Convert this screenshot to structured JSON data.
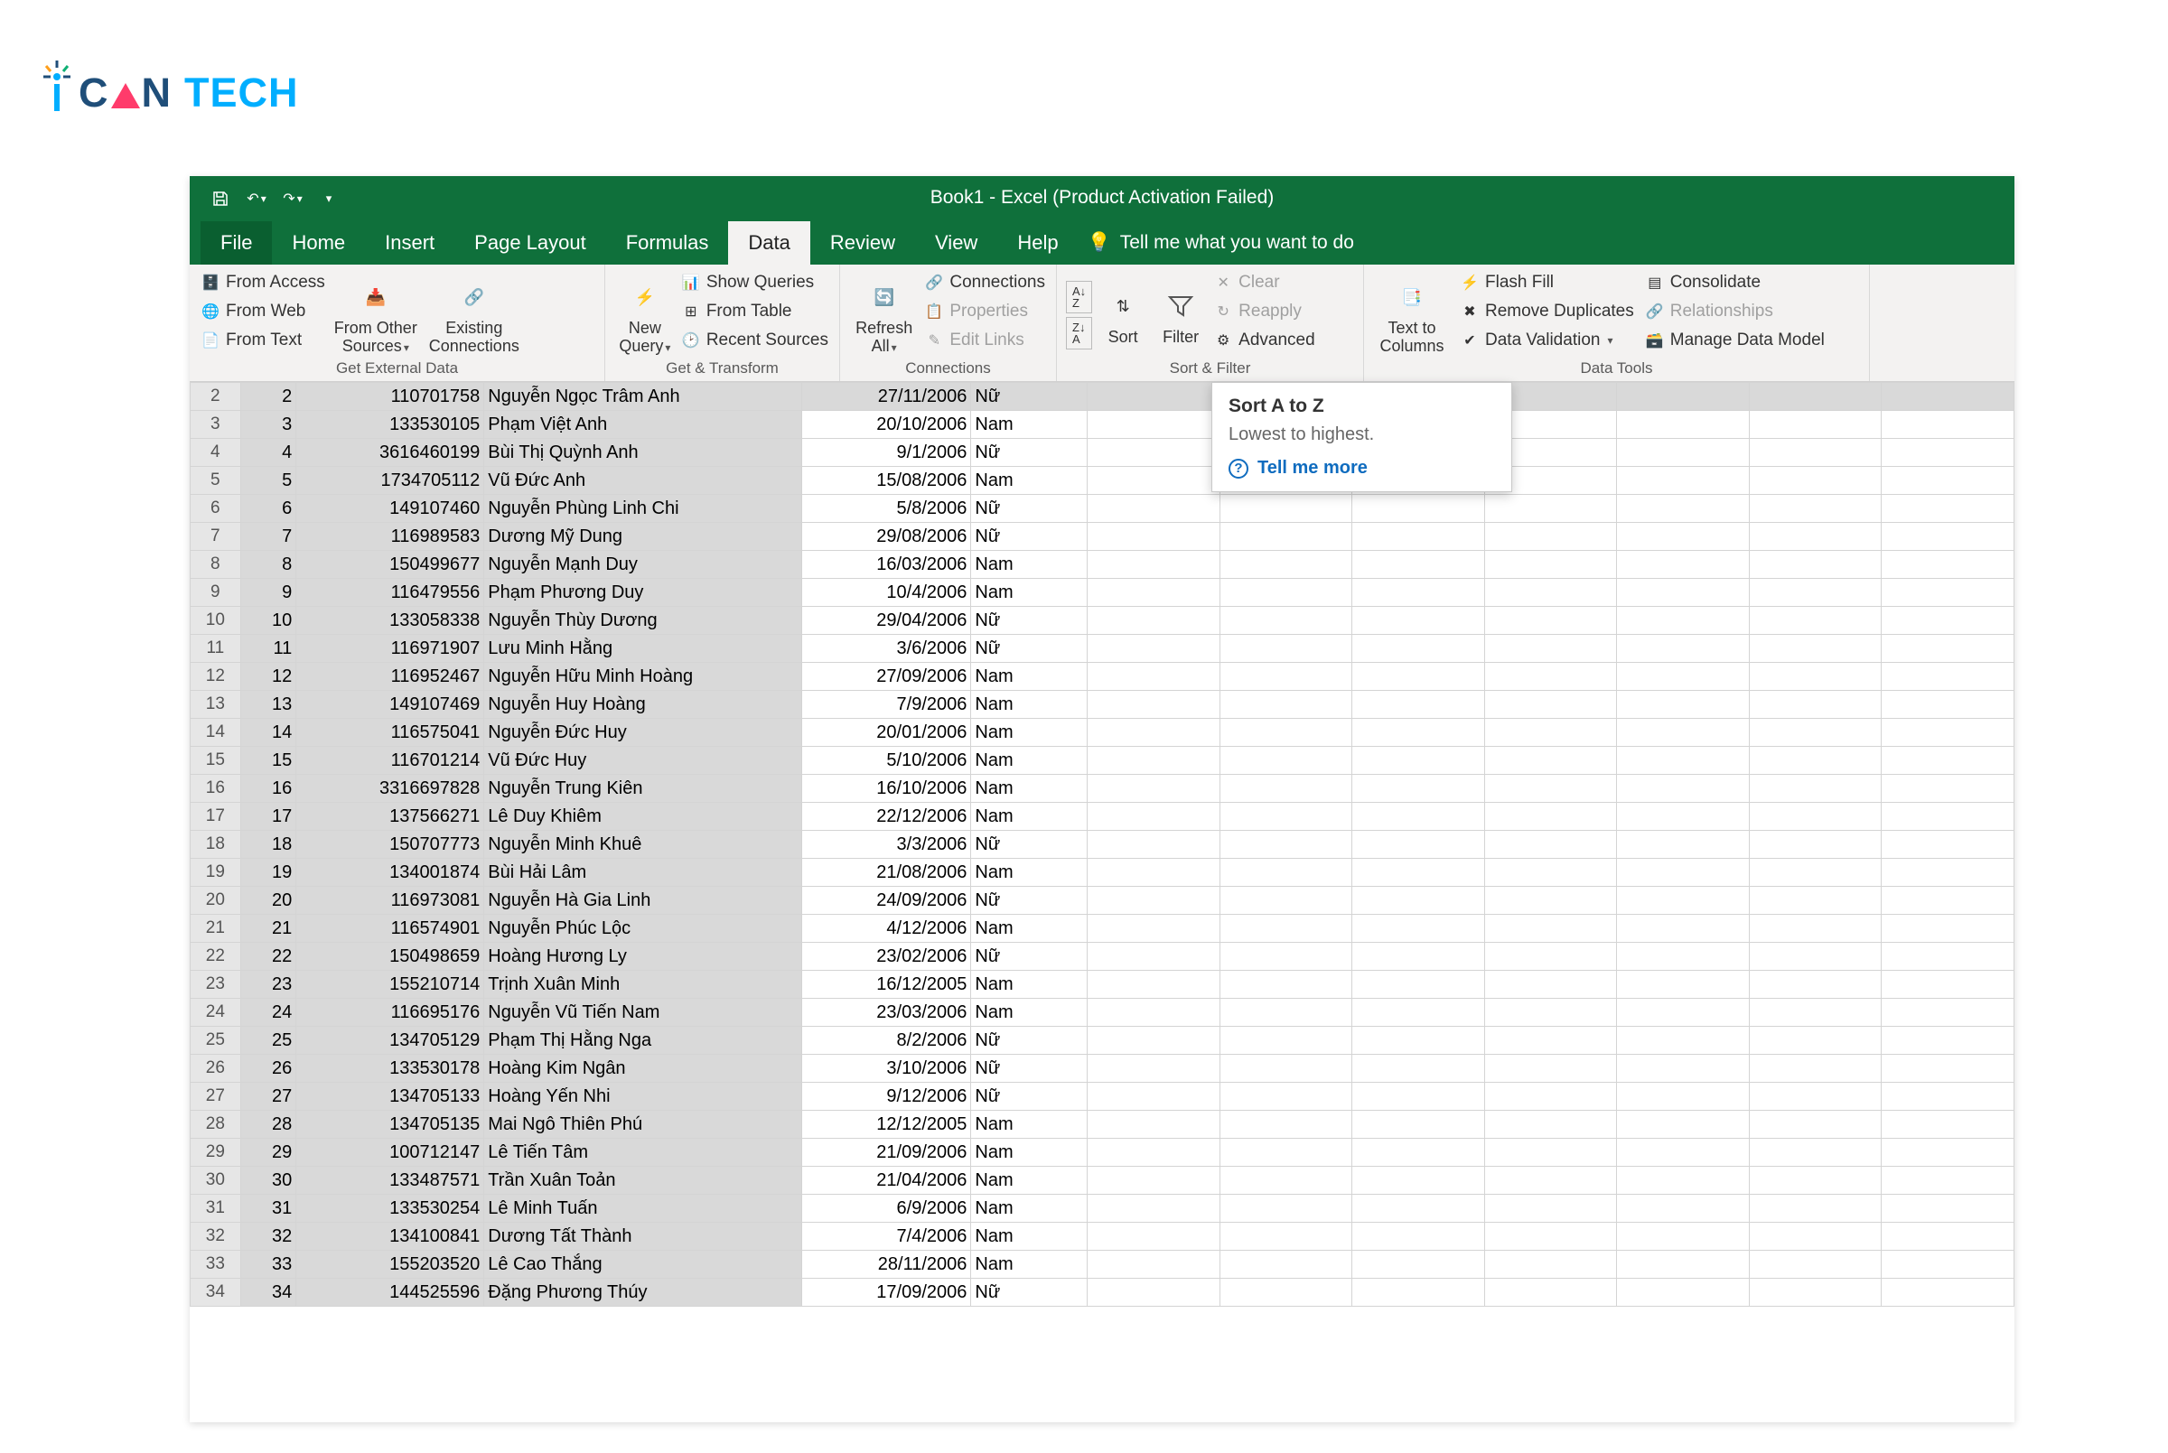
{
  "logo": {
    "part1": "C",
    "part2": "N",
    "tech": "TECH",
    "brand_i": "i"
  },
  "titlebar": {
    "doc_title": "Book1  -  Excel (Product Activation Failed)"
  },
  "menu": {
    "file": "File",
    "home": "Home",
    "insert": "Insert",
    "page_layout": "Page Layout",
    "formulas": "Formulas",
    "data": "Data",
    "review": "Review",
    "view": "View",
    "help": "Help",
    "tellme": "Tell me what you want to do"
  },
  "ribbon": {
    "get_ext": {
      "from_access": "From Access",
      "from_web": "From Web",
      "from_text": "From Text",
      "from_other": "From Other Sources",
      "existing": "Existing Connections",
      "label": "Get External Data"
    },
    "get_transform": {
      "new_query": "New Query",
      "show_queries": "Show Queries",
      "from_table": "From Table",
      "recent": "Recent Sources",
      "label": "Get & Transform"
    },
    "connections": {
      "refresh": "Refresh All",
      "connections": "Connections",
      "properties": "Properties",
      "edit_links": "Edit Links",
      "label": "Connections"
    },
    "sort_filter": {
      "sort": "Sort",
      "filter": "Filter",
      "clear": "Clear",
      "reapply": "Reapply",
      "advanced": "Advanced",
      "label": "Sort & Filter"
    },
    "data_tools": {
      "text_to_cols": "Text to Columns",
      "flash_fill": "Flash Fill",
      "remove_dupes": "Remove Duplicates",
      "data_validation": "Data Validation",
      "consolidate": "Consolidate",
      "relationships": "Relationships",
      "manage_model": "Manage Data Model",
      "label": "Data Tools"
    }
  },
  "tooltip": {
    "title": "Sort A to Z",
    "body": "Lowest to highest.",
    "more": "Tell me more"
  },
  "rows": [
    {
      "rh": "2",
      "idx": "2",
      "id": "110701758",
      "name": "Nguyễn Ngọc Trâm Anh",
      "date": "27/11/2006",
      "gen": "Nữ"
    },
    {
      "rh": "3",
      "idx": "3",
      "id": "133530105",
      "name": "Phạm Việt Anh",
      "date": "20/10/2006",
      "gen": "Nam"
    },
    {
      "rh": "4",
      "idx": "4",
      "id": "3616460199",
      "name": "Bùi Thị Quỳnh Anh",
      "date": "9/1/2006",
      "gen": "Nữ"
    },
    {
      "rh": "5",
      "idx": "5",
      "id": "1734705112",
      "name": "Vũ Đức Anh",
      "date": "15/08/2006",
      "gen": "Nam"
    },
    {
      "rh": "6",
      "idx": "6",
      "id": "149107460",
      "name": "Nguyễn Phùng Linh Chi",
      "date": "5/8/2006",
      "gen": "Nữ"
    },
    {
      "rh": "7",
      "idx": "7",
      "id": "116989583",
      "name": "Dương Mỹ Dung",
      "date": "29/08/2006",
      "gen": "Nữ"
    },
    {
      "rh": "8",
      "idx": "8",
      "id": "150499677",
      "name": "Nguyễn Mạnh Duy",
      "date": "16/03/2006",
      "gen": "Nam"
    },
    {
      "rh": "9",
      "idx": "9",
      "id": "116479556",
      "name": "Phạm Phương Duy",
      "date": "10/4/2006",
      "gen": "Nam"
    },
    {
      "rh": "10",
      "idx": "10",
      "id": "133058338",
      "name": "Nguyễn Thùy Dương",
      "date": "29/04/2006",
      "gen": "Nữ"
    },
    {
      "rh": "11",
      "idx": "11",
      "id": "116971907",
      "name": "Lưu Minh Hằng",
      "date": "3/6/2006",
      "gen": "Nữ"
    },
    {
      "rh": "12",
      "idx": "12",
      "id": "116952467",
      "name": "Nguyễn Hữu Minh Hoàng",
      "date": "27/09/2006",
      "gen": "Nam"
    },
    {
      "rh": "13",
      "idx": "13",
      "id": "149107469",
      "name": "Nguyễn Huy Hoàng",
      "date": "7/9/2006",
      "gen": "Nam"
    },
    {
      "rh": "14",
      "idx": "14",
      "id": "116575041",
      "name": "Nguyễn Đức Huy",
      "date": "20/01/2006",
      "gen": "Nam"
    },
    {
      "rh": "15",
      "idx": "15",
      "id": "116701214",
      "name": "Vũ Đức Huy",
      "date": "5/10/2006",
      "gen": "Nam"
    },
    {
      "rh": "16",
      "idx": "16",
      "id": "3316697828",
      "name": "Nguyễn Trung Kiên",
      "date": "16/10/2006",
      "gen": "Nam"
    },
    {
      "rh": "17",
      "idx": "17",
      "id": "137566271",
      "name": "Lê Duy Khiêm",
      "date": "22/12/2006",
      "gen": "Nam"
    },
    {
      "rh": "18",
      "idx": "18",
      "id": "150707773",
      "name": "Nguyễn Minh Khuê",
      "date": "3/3/2006",
      "gen": "Nữ"
    },
    {
      "rh": "19",
      "idx": "19",
      "id": "134001874",
      "name": "Bùi Hải Lâm",
      "date": "21/08/2006",
      "gen": "Nam"
    },
    {
      "rh": "20",
      "idx": "20",
      "id": "116973081",
      "name": "Nguyễn Hà Gia Linh",
      "date": "24/09/2006",
      "gen": "Nữ"
    },
    {
      "rh": "21",
      "idx": "21",
      "id": "116574901",
      "name": "Nguyễn Phúc Lộc",
      "date": "4/12/2006",
      "gen": "Nam"
    },
    {
      "rh": "22",
      "idx": "22",
      "id": "150498659",
      "name": "Hoàng Hương Ly",
      "date": "23/02/2006",
      "gen": "Nữ"
    },
    {
      "rh": "23",
      "idx": "23",
      "id": "155210714",
      "name": "Trịnh Xuân Minh",
      "date": "16/12/2005",
      "gen": "Nam"
    },
    {
      "rh": "24",
      "idx": "24",
      "id": "116695176",
      "name": "Nguyễn Vũ Tiến Nam",
      "date": "23/03/2006",
      "gen": "Nam"
    },
    {
      "rh": "25",
      "idx": "25",
      "id": "134705129",
      "name": "Phạm Thị Hằng Nga",
      "date": "8/2/2006",
      "gen": "Nữ"
    },
    {
      "rh": "26",
      "idx": "26",
      "id": "133530178",
      "name": "Hoàng Kim Ngân",
      "date": "3/10/2006",
      "gen": "Nữ"
    },
    {
      "rh": "27",
      "idx": "27",
      "id": "134705133",
      "name": "Hoàng Yến Nhi",
      "date": "9/12/2006",
      "gen": "Nữ"
    },
    {
      "rh": "28",
      "idx": "28",
      "id": "134705135",
      "name": "Mai Ngô Thiên Phú",
      "date": "12/12/2005",
      "gen": "Nam"
    },
    {
      "rh": "29",
      "idx": "29",
      "id": "100712147",
      "name": "Lê Tiến Tâm",
      "date": "21/09/2006",
      "gen": "Nam"
    },
    {
      "rh": "30",
      "idx": "30",
      "id": "133487571",
      "name": "Trần Xuân Toản",
      "date": "21/04/2006",
      "gen": "Nam"
    },
    {
      "rh": "31",
      "idx": "31",
      "id": "133530254",
      "name": "Lê Minh Tuấn",
      "date": "6/9/2006",
      "gen": "Nam"
    },
    {
      "rh": "32",
      "idx": "32",
      "id": "134100841",
      "name": "Dương Tất Thành",
      "date": "7/4/2006",
      "gen": "Nam"
    },
    {
      "rh": "33",
      "idx": "33",
      "id": "155203520",
      "name": "Lê Cao Thắng",
      "date": "28/11/2006",
      "gen": "Nam"
    },
    {
      "rh": "34",
      "idx": "34",
      "id": "144525596",
      "name": "Đặng Phương Thúy",
      "date": "17/09/2006",
      "gen": "Nữ"
    }
  ]
}
